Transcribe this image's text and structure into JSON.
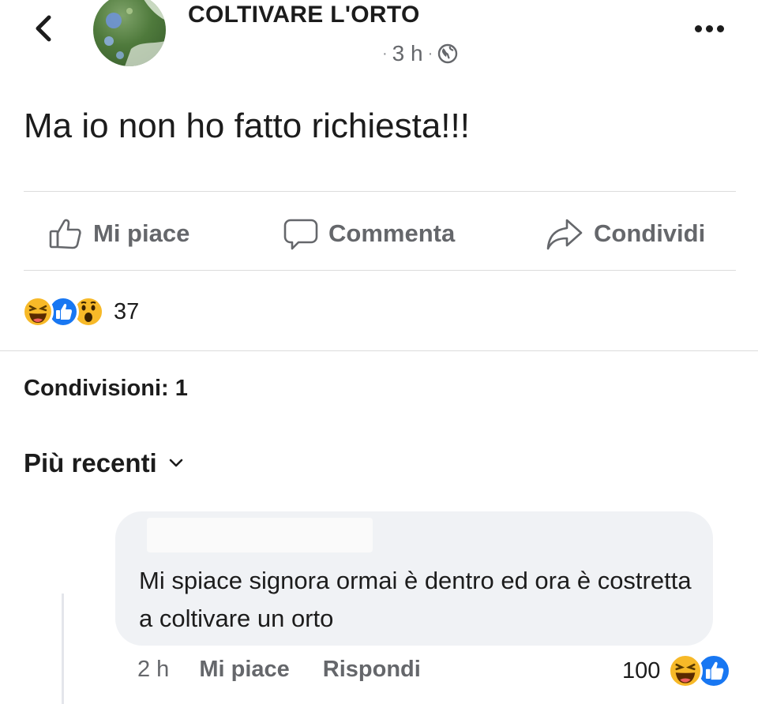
{
  "header": {
    "page_name": "COLTIVARE L'ORTO",
    "time": "3 h",
    "separator": "·",
    "audience_icon": "globe-icon",
    "back_icon": "chevron-left-icon",
    "more_icon": "more-dots-icon"
  },
  "post": {
    "text": "Ma io non ho fatto richiesta!!!"
  },
  "actions": {
    "like": "Mi piace",
    "comment": "Commenta",
    "share": "Condividi"
  },
  "reactions": {
    "icons": [
      "haha-icon",
      "like-icon",
      "wow-icon"
    ],
    "count": "37"
  },
  "shares": {
    "label": "Condivisioni: 1"
  },
  "sort": {
    "label": "Più recenti"
  },
  "comment": {
    "text": "Mi spiace signora ormai è dentro ed ora è costretta a coltivare un orto",
    "time": "2 h",
    "like": "Mi piace",
    "reply": "Rispondi",
    "reaction_count": "100",
    "reaction_icons": [
      "haha-icon",
      "like-icon"
    ]
  },
  "colors": {
    "like_blue": "#1877f2",
    "haha_yellow": "#f7b928",
    "muted_text": "#65676b",
    "bubble_bg": "#f0f2f5"
  }
}
